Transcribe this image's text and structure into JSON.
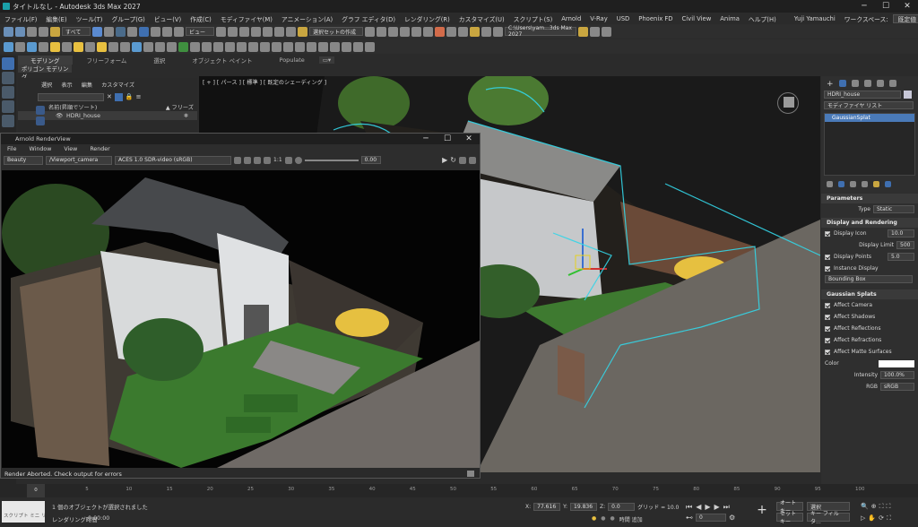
{
  "window": {
    "title": "タイトルなし - Autodesk 3ds Max 2027",
    "user": "Yuji Yamauchi",
    "workspace_label": "ワークスペース:",
    "workspace_value": "既定値"
  },
  "menu": [
    "ファイル(F)",
    "編集(E)",
    "ツール(T)",
    "グループ(G)",
    "ビュー(V)",
    "作成(C)",
    "モディファイヤ(M)",
    "アニメーション(A)",
    "グラフ エディタ(D)",
    "レンダリング(R)",
    "カスタマイズ(U)",
    "スクリプト(S)",
    "Arnold",
    "V-Ray",
    "USD",
    "Phoenix FD",
    "Civil View",
    "Anima",
    "ヘルプ(H)"
  ],
  "toolbar": {
    "selection_filter": "すべて",
    "view_combo": "ビュー",
    "selection_set": "選択セットの作成",
    "project_path": "C:\\Users\\yam...3ds Max 2027"
  },
  "ribbon": {
    "tabs": [
      "モデリング",
      "フリーフォーム",
      "選択",
      "オブジェクト ペイント",
      "Populate"
    ],
    "sub_label": "ポリゴン モデリング"
  },
  "scene_explorer": {
    "menu": [
      "選択",
      "表示",
      "編集",
      "カスタマイズ"
    ],
    "header_name": "名前(昇順でソート)",
    "header_freeze": "▲ フリーズ",
    "object": "HDRI_house"
  },
  "viewport": {
    "label": "[ + ] [ パース ] [ 標準 ] [ 既定のシェーディング ]"
  },
  "render_window": {
    "title": "Arnold RenderView",
    "menu": [
      "File",
      "Window",
      "View",
      "Render"
    ],
    "aov": "Beauty",
    "camera": "/Viewport_camera",
    "color_space": "ACES 1.0 SDR-video (sRGB)",
    "zoom": "1:1",
    "exposure": "0.00",
    "status": "Render Aborted. Check output for errors"
  },
  "command_panel": {
    "object_name": "HDRI_house",
    "modifier_list": "モディファイヤ リスト",
    "stack_item": "GaussianSplat",
    "parameters_title": "Parameters",
    "type_label": "Type",
    "type_value": "Static",
    "display_title": "Display and Rendering",
    "display_icon": "Display Icon",
    "display_icon_value": "10.0",
    "display_limit": "Display Limit",
    "display_limit_value": "500",
    "display_points": "Display Points",
    "display_points_value": "5.0",
    "instance_display": "Instance Display",
    "instance_value": "Bounding Box",
    "splats_title": "Gaussian Splats",
    "affect": [
      "Affect Camera",
      "Affect Shadows",
      "Affect Reflections",
      "Affect Refractions",
      "Affect Matte Surfaces"
    ],
    "color_label": "Color",
    "intensity_label": "Intensity",
    "intensity_value": "100.0%",
    "rgb_label": "RGB",
    "rgb_value": "sRGB"
  },
  "timeline": {
    "frame_start": "0",
    "frame_end": "100",
    "ticks": [
      "5",
      "10",
      "15",
      "20",
      "25",
      "30",
      "35",
      "40",
      "45",
      "50",
      "55",
      "60",
      "65",
      "70",
      "75",
      "80",
      "85",
      "90",
      "95",
      "100"
    ]
  },
  "status": {
    "script_label": "スクリプト ミニ リス",
    "selection_msg": "1 個のオブジェクトが選択されました",
    "render_time_label": "レンダリング時間",
    "render_time": "0:00:00",
    "x_label": "X:",
    "x_value": "77.616",
    "y_label": "Y:",
    "y_value": "19.836",
    "z_label": "Z:",
    "z_value": "0.0",
    "grid_label": "グリッド = 10.0",
    "time_tag": "時間 追加",
    "auto_key": "オート キー",
    "set_key": "セット キー",
    "key_filter": "キー フィルタ...",
    "selection": "選択",
    "frame": "0"
  },
  "colors": {
    "accent_blue": "#3a6fb0",
    "point_cyan": "#33d6e8",
    "roof": "#4a4f55",
    "wall": "#d9dcdf",
    "grass": "#3f7a34",
    "car": "#e8c040"
  }
}
